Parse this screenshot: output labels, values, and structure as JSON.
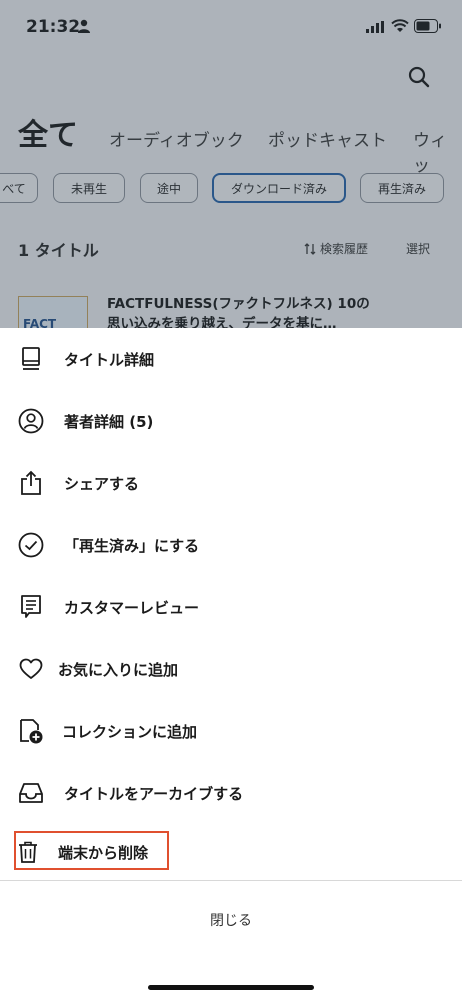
{
  "status_bar": {
    "time": "21:32"
  },
  "header": {
    "tabs": [
      "全て",
      "オーディオブック",
      "ポッドキャスト",
      "ウィッ"
    ]
  },
  "filters": [
    "べて",
    "未再生",
    "途中",
    "ダウンロード済み",
    "再生済み"
  ],
  "selected_filter": "ダウンロード済み",
  "library": {
    "count": "1 タイトル",
    "sort_label": "検索履歴",
    "select_label": "選択",
    "book": {
      "cover_text": "FACT",
      "title_line1": "FACTFULNESS(ファクトフルネス) 10の",
      "title_line2": "思い込みを乗り越え、データを基に…"
    }
  },
  "menu": {
    "items": [
      {
        "label": "タイトル詳細",
        "icon": "book-icon"
      },
      {
        "label": "著者詳細 (5)",
        "icon": "person-icon"
      },
      {
        "label": "シェアする",
        "icon": "share-icon"
      },
      {
        "label": "「再生済み」にする",
        "icon": "check-circle-icon"
      },
      {
        "label": "カスタマーレビュー",
        "icon": "review-icon"
      },
      {
        "label": "お気に入りに追加",
        "icon": "heart-icon"
      },
      {
        "label": "コレクションに追加",
        "icon": "collection-add-icon"
      },
      {
        "label": "タイトルをアーカイブする",
        "icon": "archive-icon"
      },
      {
        "label": "端末から削除",
        "icon": "trash-icon"
      }
    ],
    "close_label": "閉じる"
  },
  "colors": {
    "highlight": "#e0502f",
    "selected_chip": "#1f5ea8",
    "overlay": "rgba(60,75,90,0.38)"
  }
}
